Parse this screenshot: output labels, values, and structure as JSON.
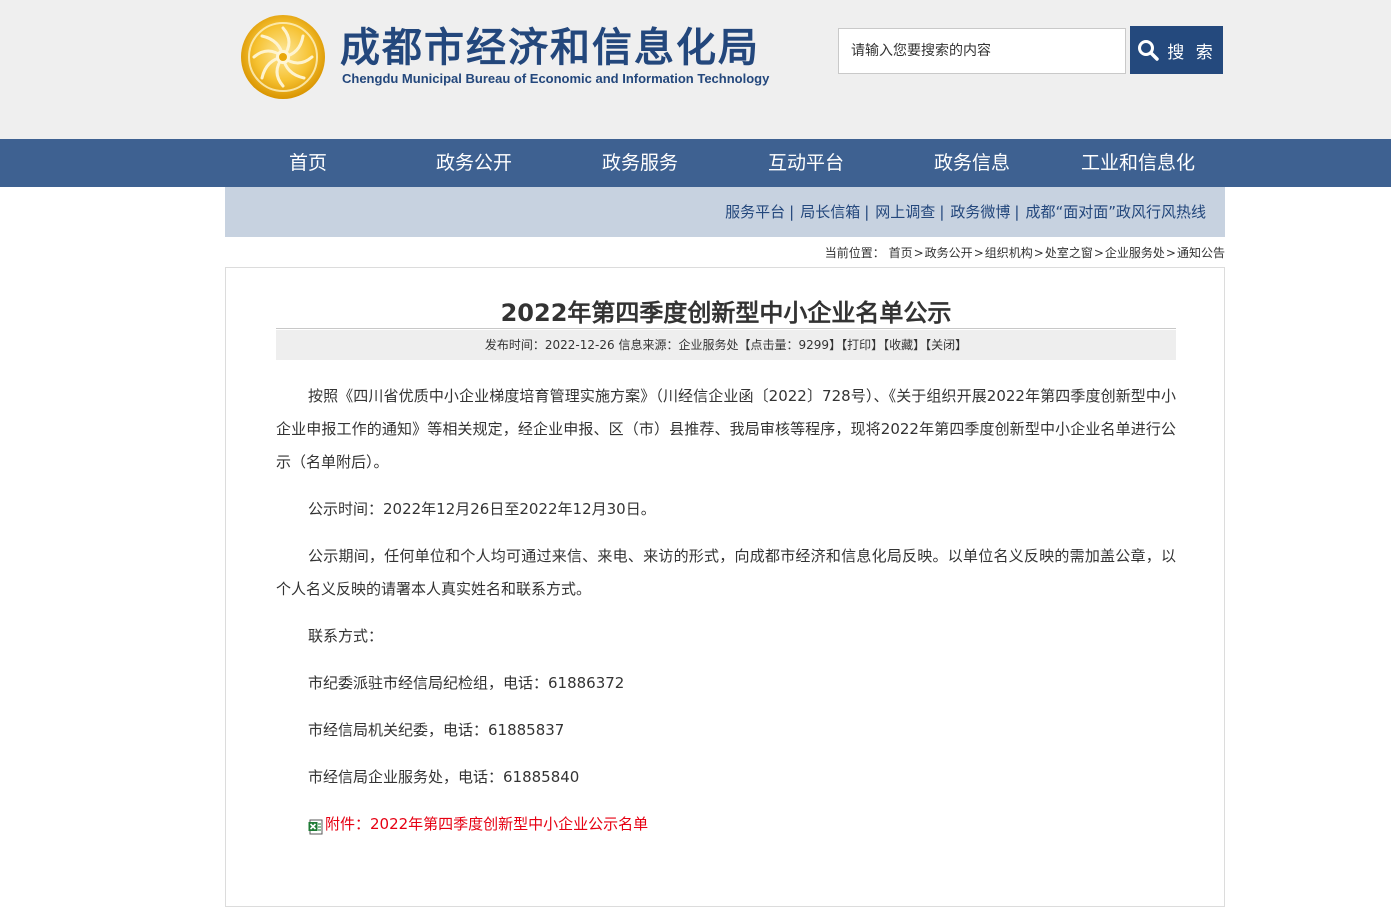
{
  "header": {
    "title_cn": "成都市经济和信息化局",
    "title_en": "Chengdu Municipal Bureau of Economic and Information Technology",
    "search_placeholder": "请输入您要搜索的内容",
    "search_button": "搜 索",
    "brand_color": "#23477c",
    "logo_color": "#f2b51c"
  },
  "nav": {
    "items": [
      {
        "label": "首页"
      },
      {
        "label": "政务公开"
      },
      {
        "label": "政务服务"
      },
      {
        "label": "互动平台"
      },
      {
        "label": "政务信息"
      },
      {
        "label": "工业和信息化"
      }
    ],
    "bg_color": "#3e6191"
  },
  "subnav": {
    "items": [
      {
        "label": "服务平台"
      },
      {
        "label": "局长信箱"
      },
      {
        "label": "网上调查"
      },
      {
        "label": "政务微博"
      },
      {
        "label": "成都“面对面”政风行风热线"
      }
    ],
    "separator": "|"
  },
  "breadcrumb": {
    "prefix": "当前位置：",
    "items": [
      "首页",
      "政务公开",
      "组织机构",
      "处室之窗",
      "企业服务处",
      "通知公告"
    ],
    "separator": ">"
  },
  "article": {
    "title": "2022年第四季度创新型中小企业名单公示",
    "meta": {
      "date_label": "发布时间：",
      "date": "2022-12-26",
      "source_label": "信息来源：",
      "source": "企业服务处",
      "clicks_label": "【点击量：",
      "clicks": "9299",
      "clicks_suffix": "】",
      "print": "【打印】",
      "favorite": "【收藏】",
      "close": "【关闭】"
    },
    "paragraphs": [
      "按照《四川省优质中小企业梯度培育管理实施方案》（川经信企业函〔2022〕728号）、《关于组织开展2022年第四季度创新型中小企业申报工作的通知》等相关规定，经企业申报、区（市）县推荐、我局审核等程序，现将2022年第四季度创新型中小企业名单进行公示（名单附后）。",
      "公示时间：2022年12月26日至2022年12月30日。",
      "公示期间，任何单位和个人均可通过来信、来电、来访的形式，向成都市经济和信息化局反映。以单位名义反映的需加盖公章，以个人名义反映的请署本人真实姓名和联系方式。",
      "联系方式：",
      "市纪委派驻市经信局纪检组，电话：61886372",
      "市经信局机关纪委，电话：61885837",
      "市经信局企业服务处，电话：61885840"
    ],
    "attachment": "附件：2022年第四季度创新型中小企业公示名单",
    "attachment_color": "#e60012"
  }
}
